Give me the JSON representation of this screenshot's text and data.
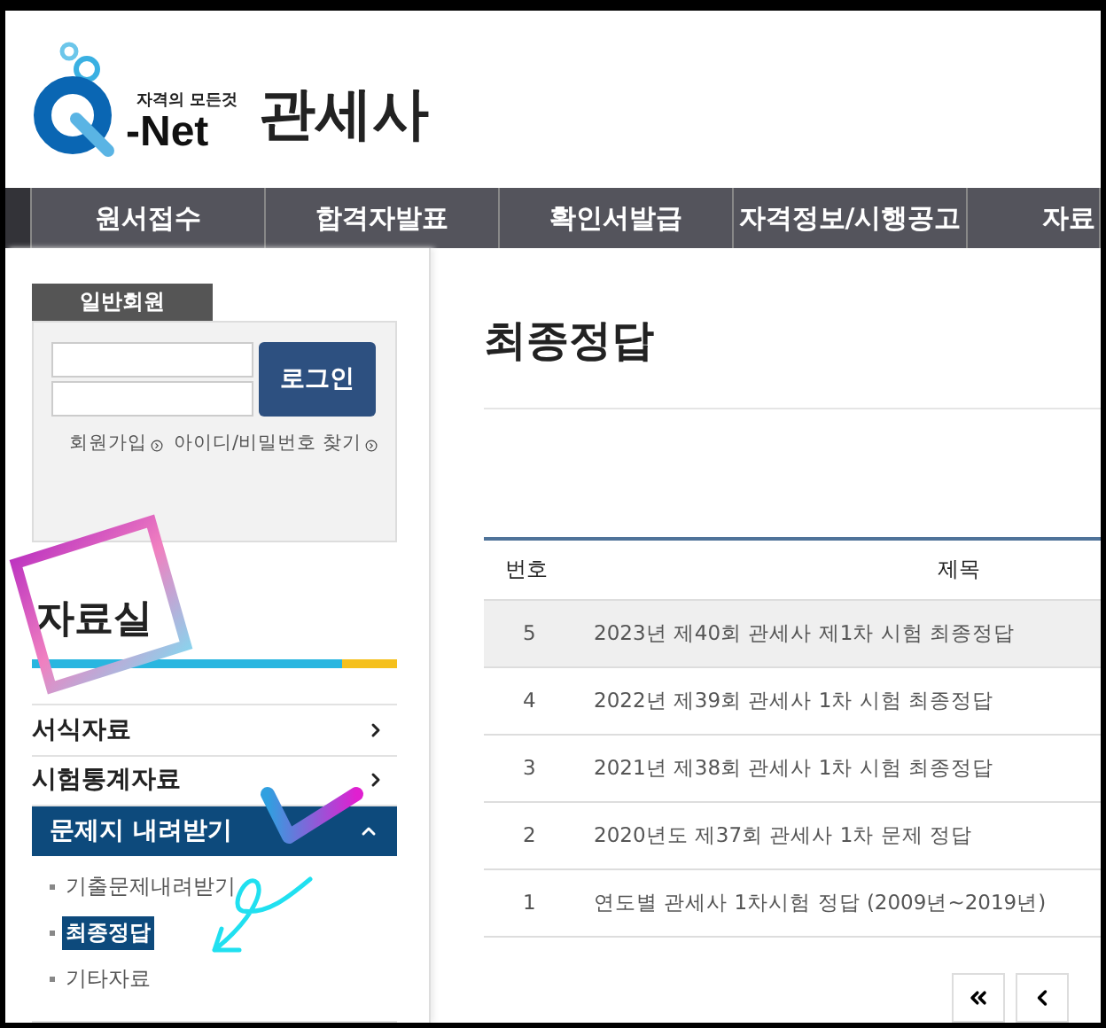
{
  "header": {
    "logo_tagline": "자격의 모든것",
    "logo_text": "-Net",
    "title": "관세사"
  },
  "nav": [
    "원서접수",
    "합격자발표",
    "확인서발급",
    "자격정보/시행공고",
    "자료"
  ],
  "login": {
    "tab": "일반회원",
    "button": "로그인",
    "links": [
      "회원가입",
      "아이디/비밀번호 찾기"
    ]
  },
  "sidebar": {
    "title": "자료실",
    "items": [
      {
        "label": "서식자료",
        "expanded": false
      },
      {
        "label": "시험통계자료",
        "expanded": false
      },
      {
        "label": "문제지 내려받기",
        "expanded": true,
        "children": [
          {
            "label": "기출문제내려받기",
            "selected": false
          },
          {
            "label": "최종정답",
            "selected": true
          },
          {
            "label": "기타자료",
            "selected": false
          }
        ]
      }
    ]
  },
  "content": {
    "title": "최종정답",
    "table": {
      "columns": [
        "번호",
        "제목"
      ],
      "rows": [
        {
          "cells": [
            "5",
            "2023년 제40회 관세사 제1차 시험 최종정답"
          ],
          "highlighted": true
        },
        {
          "cells": [
            "4",
            "2022년 제39회 관세사 1차 시험 최종정답"
          ],
          "highlighted": false
        },
        {
          "cells": [
            "3",
            "2021년 제38회 관세사 1차 시험 최종정답"
          ],
          "highlighted": false
        },
        {
          "cells": [
            "2",
            "2020년도 제37회 관세사 1차 문제 정답"
          ],
          "highlighted": false
        },
        {
          "cells": [
            "1",
            "연도별 관세사 1차시험 정답 (2009년~2019년)"
          ],
          "highlighted": false
        }
      ]
    }
  }
}
